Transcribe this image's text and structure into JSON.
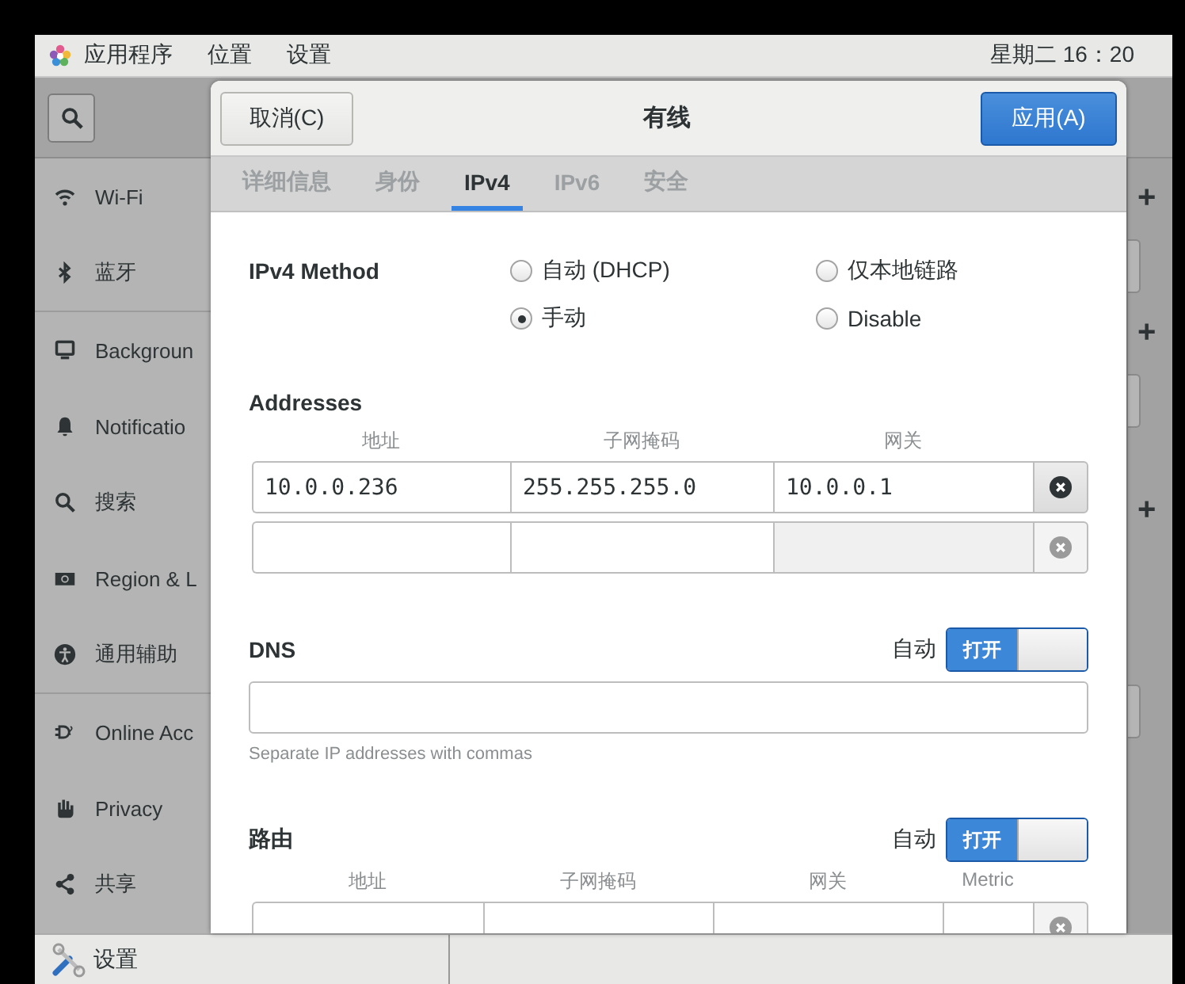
{
  "top_bar": {
    "menus": [
      "应用程序",
      "位置",
      "设置"
    ],
    "clock": "星期二 16：20"
  },
  "sidebar": {
    "groups": [
      [
        {
          "label": "Wi-Fi"
        },
        {
          "label": "蓝牙"
        }
      ],
      [
        {
          "label": "Backgroun"
        },
        {
          "label": "Notificatio"
        },
        {
          "label": "搜索"
        },
        {
          "label": "Region & L"
        },
        {
          "label": "通用辅助"
        }
      ],
      [
        {
          "label": "Online Acc"
        },
        {
          "label": "Privacy"
        },
        {
          "label": "共享"
        }
      ]
    ]
  },
  "dialog": {
    "title": "有线",
    "cancel": "取消(C)",
    "apply": "应用(A)",
    "tabs": [
      {
        "label": "详细信息",
        "selected": false
      },
      {
        "label": "身份",
        "selected": false
      },
      {
        "label": "IPv4",
        "selected": true
      },
      {
        "label": "IPv6",
        "selected": false
      },
      {
        "label": "安全",
        "selected": false
      }
    ],
    "method": {
      "label": "IPv4 Method",
      "options": [
        {
          "label": "自动 (DHCP)",
          "selected": false
        },
        {
          "label": "仅本地链路",
          "selected": false
        },
        {
          "label": "手动",
          "selected": true
        },
        {
          "label": "Disable",
          "selected": false
        }
      ]
    },
    "addresses": {
      "title": "Addresses",
      "columns": [
        "地址",
        "子网掩码",
        "网关"
      ],
      "rows": [
        {
          "fields": [
            {
              "value": "10.0.0.236",
              "disabled": false
            },
            {
              "value": "255.255.255.0",
              "disabled": false
            },
            {
              "value": "10.0.0.1",
              "disabled": false
            }
          ],
          "remove_disabled": false
        },
        {
          "fields": [
            {
              "disabled": false
            },
            {
              "disabled": false
            },
            {
              "disabled": true
            }
          ],
          "remove_disabled": true
        }
      ]
    },
    "dns": {
      "title": "DNS",
      "auto_label": "自动",
      "switch": {
        "label": "打开",
        "on": true
      },
      "hint": "Separate IP addresses with commas"
    },
    "routes": {
      "title": "路由",
      "auto_label": "自动",
      "switch": {
        "label": "打开",
        "on": true
      },
      "columns": [
        "地址",
        "子网掩码",
        "网关",
        "Metric"
      ],
      "rows": [
        {
          "remove_disabled": true
        }
      ]
    }
  },
  "background_list": {
    "add_buttons": [
      "+",
      "+",
      "+"
    ]
  },
  "taskbar": {
    "items": [
      {
        "label": "设置"
      }
    ]
  }
}
